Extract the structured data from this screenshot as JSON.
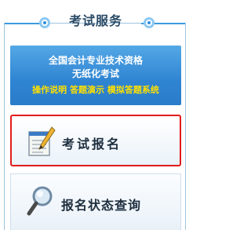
{
  "header": {
    "title": "考试服务"
  },
  "banner": {
    "line1": "全国会计专业技术资格",
    "line2": "无纸化考试",
    "line3": "操作说明 答题演示 模拟答题系统"
  },
  "menu": {
    "registration_label": "考试报名",
    "status_query_label": "报名状态查询"
  },
  "colors": {
    "accent": "#3b9be0",
    "banner": "#2f84d2",
    "highlight_text": "#ffe000",
    "selection_border": "#e21b1b"
  },
  "icons": {
    "registration": "notepad-pencil-icon",
    "status_query": "magnifier-icon"
  }
}
